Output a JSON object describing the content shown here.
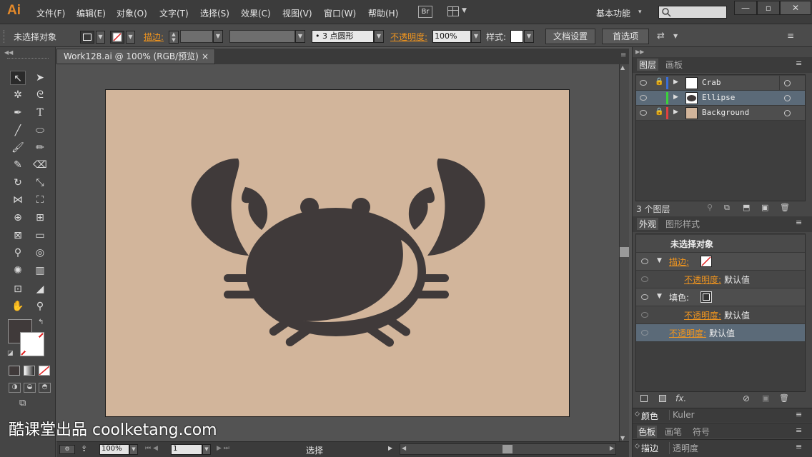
{
  "app": {
    "logo": "Ai",
    "br": "Br",
    "workspace": "基本功能",
    "search_placeholder": ""
  },
  "menus": [
    "文件(F)",
    "编辑(E)",
    "对象(O)",
    "文字(T)",
    "选择(S)",
    "效果(C)",
    "视图(V)",
    "窗口(W)",
    "帮助(H)"
  ],
  "window_controls": [
    "—",
    "▫",
    "✕"
  ],
  "control": {
    "selection": "未选择对象",
    "stroke_label": "描边:",
    "brush": "• 3 点圆形",
    "opacity_label": "不透明度:",
    "opacity_value": "100%",
    "style_label": "样式:",
    "doc_setup": "文档设置",
    "prefs": "首选项"
  },
  "document": {
    "tab_title": "Work128.ai @ 100% (RGB/预览)",
    "close": "×"
  },
  "status": {
    "zoom": "100%",
    "page": "1",
    "tool": "选择"
  },
  "layers_panel": {
    "tabs": [
      "图层",
      "画板"
    ],
    "rows": [
      {
        "name": "Crab",
        "color": "#3a6fd8",
        "locked": true
      },
      {
        "name": "Ellipse",
        "color": "#3bd23b",
        "locked": false
      },
      {
        "name": "Background",
        "color": "#e04040",
        "locked": true
      }
    ],
    "count": "3 个图层"
  },
  "appearance_panel": {
    "tabs": [
      "外观",
      "图形样式"
    ],
    "title": "未选择对象",
    "stroke": "描边:",
    "opacity": "不透明度:",
    "default": "默认值",
    "fill": "填色:",
    "fx": "fx."
  },
  "bottom_panels": {
    "row1": [
      "颜色",
      "Kuler"
    ],
    "row2": [
      "色板",
      "画笔",
      "符号"
    ],
    "row3": [
      "描边",
      "透明度"
    ]
  },
  "watermark": "酷课堂出品 coolketang.com",
  "colors": {
    "crab": "#403a3a",
    "background": "#d2b59b",
    "accent": "#f0951f"
  }
}
